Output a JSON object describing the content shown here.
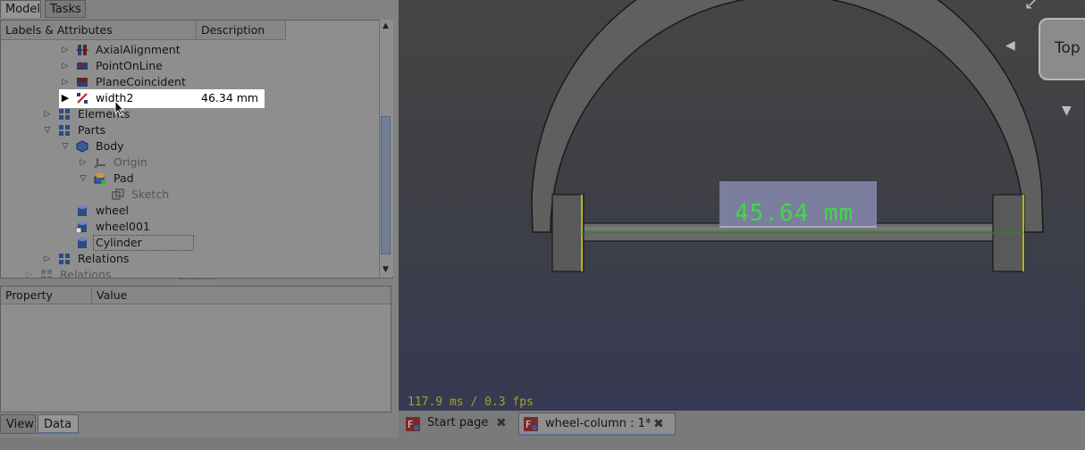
{
  "panel_tabs": [
    "Model",
    "Tasks"
  ],
  "tree": {
    "columns": [
      "Labels & Attributes",
      "Description"
    ],
    "rows": [
      {
        "label": "AxialAlignment",
        "desc": "",
        "icon": "axial-alignment-icon"
      },
      {
        "label": "PointOnLine",
        "desc": "",
        "icon": "point-on-line-icon"
      },
      {
        "label": "PlaneCoincident",
        "desc": "",
        "icon": "plane-coincident-icon"
      },
      {
        "label": "width2",
        "desc": "46.34 mm",
        "icon": "distance-constraint-icon"
      },
      {
        "label": "Elements",
        "desc": "",
        "icon": "elements-group-icon"
      },
      {
        "label": "Parts",
        "desc": "",
        "icon": "parts-group-icon"
      },
      {
        "label": "Body",
        "desc": "",
        "icon": "body-icon"
      },
      {
        "label": "Origin",
        "desc": "",
        "icon": "origin-icon"
      },
      {
        "label": "Pad",
        "desc": "",
        "icon": "pad-icon"
      },
      {
        "label": "Sketch",
        "desc": "",
        "icon": "sketch-icon"
      },
      {
        "label": "wheel",
        "desc": "",
        "icon": "cylinder-icon"
      },
      {
        "label": "wheel001",
        "desc": "",
        "icon": "cylinder-link-icon"
      },
      {
        "label": "Cylinder",
        "desc": "",
        "icon": "cylinder-icon"
      },
      {
        "label": "Relations",
        "desc": "",
        "icon": "relations-icon"
      },
      {
        "label": "Relations",
        "desc": "",
        "icon": "relations-icon"
      }
    ]
  },
  "properties": {
    "columns": [
      "Property",
      "Value"
    ]
  },
  "bottom_tabs": [
    "View",
    "Data"
  ],
  "viewport": {
    "dimension_label": "45.64 mm",
    "fps": "117.9 ms / 0.3 fps",
    "navcube_face": "Top"
  },
  "doc_tabs": [
    {
      "label": "Start page"
    },
    {
      "label": "wheel-column : 1*"
    }
  ],
  "colors": {
    "dimension": "#3ddc3d",
    "highlight_row": "#ffffff",
    "selection": "#6f7e95"
  }
}
